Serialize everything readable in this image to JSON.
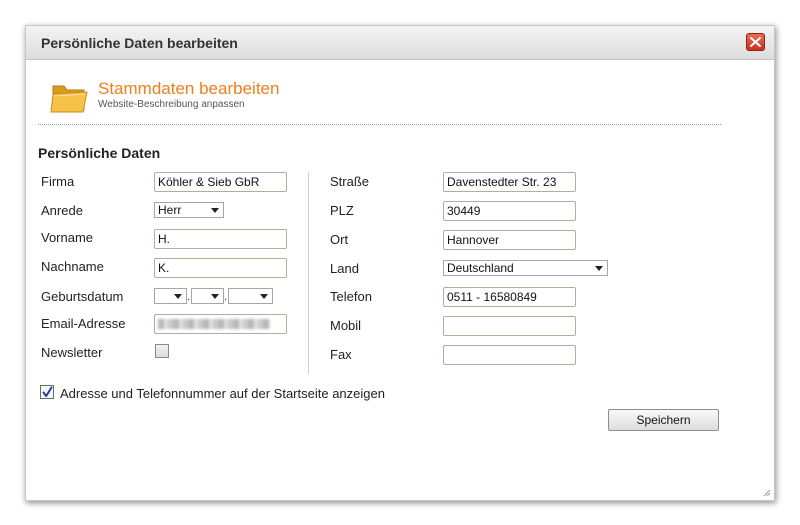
{
  "dialog": {
    "title": "Persönliche Daten bearbeiten"
  },
  "header": {
    "icon": "folder-icon",
    "title": "Stammdaten bearbeiten",
    "subtitle": "Website-Beschreibung anpassen"
  },
  "section": {
    "title": "Persönliche Daten"
  },
  "left_fields": {
    "firma": {
      "label": "Firma",
      "value": "Köhler & Sieb GbR"
    },
    "anrede": {
      "label": "Anrede",
      "value": "Herr"
    },
    "vorname": {
      "label": "Vorname",
      "value": "H."
    },
    "nachname": {
      "label": "Nachname",
      "value": "K."
    },
    "geburtsdatum": {
      "label": "Geburtsdatum",
      "day": "",
      "month": "",
      "year": "",
      "separator": "."
    },
    "email": {
      "label": "Email-Adresse",
      "value": ""
    },
    "newsletter": {
      "label": "Newsletter",
      "checked": false
    }
  },
  "right_fields": {
    "strasse": {
      "label": "Straße",
      "value": "Davenstedter Str. 23"
    },
    "plz": {
      "label": "PLZ",
      "value": "30449"
    },
    "ort": {
      "label": "Ort",
      "value": "Hannover"
    },
    "land": {
      "label": "Land",
      "value": "Deutschland"
    },
    "telefon": {
      "label": "Telefon",
      "value": "0511 - 16580849"
    },
    "mobil": {
      "label": "Mobil",
      "value": ""
    },
    "fax": {
      "label": "Fax",
      "value": ""
    }
  },
  "show_on_startpage": {
    "label": "Adresse und Telefonnummer auf der Startseite anzeigen",
    "checked": true
  },
  "buttons": {
    "save": "Speichern"
  },
  "colors": {
    "accent": "#ef7f1a",
    "close_button": "#d9472f"
  }
}
